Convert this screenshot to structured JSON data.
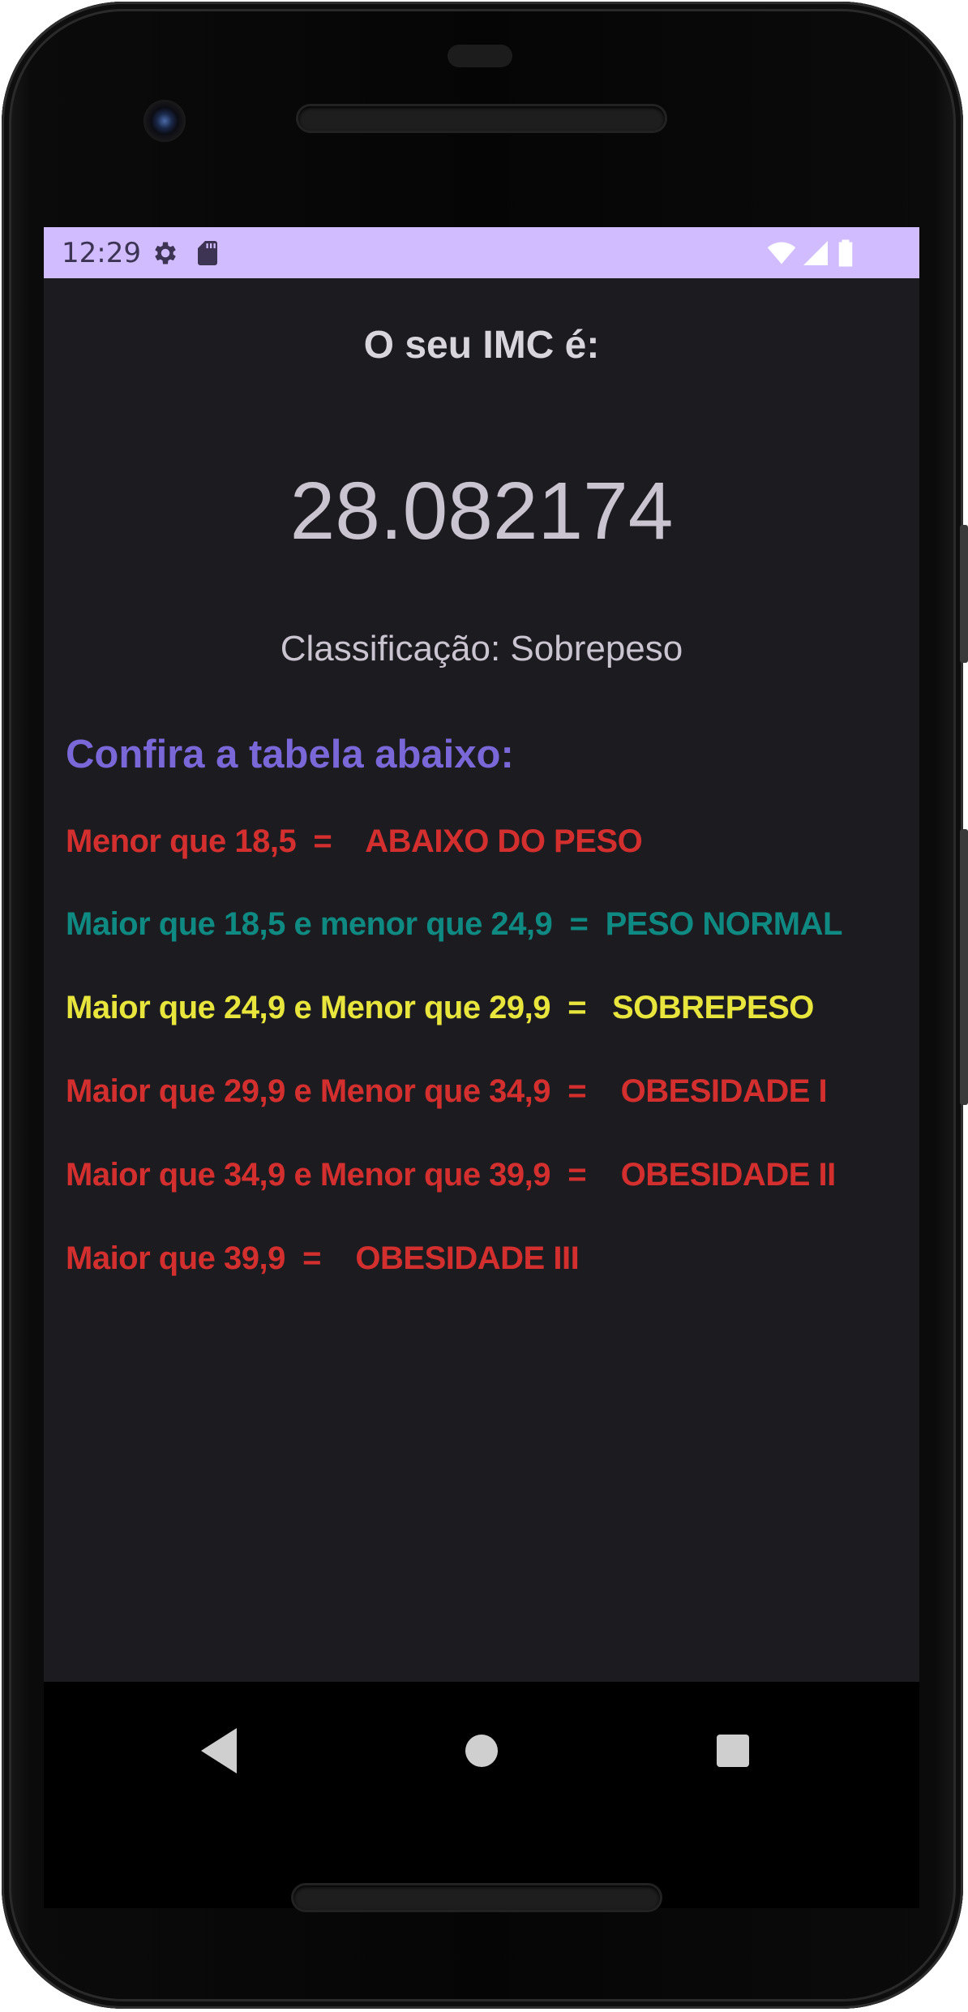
{
  "status_bar": {
    "time": "12:29",
    "icons": [
      "gear-icon",
      "sd-card-icon",
      "wifi-icon",
      "signal-icon",
      "battery-icon"
    ]
  },
  "screen": {
    "title": "O seu IMC é:",
    "imc_value": "28.082174",
    "classification": "Classificação: Sobrepeso",
    "table_heading": "Confira a tabela abaixo:"
  },
  "table": [
    {
      "text": "Menor que 18,5  =    ABAIXO DO PESO",
      "color": "#d32f2f"
    },
    {
      "text": "Maior que 18,5 e menor que 24,9  =  PESO NORMAL",
      "color": "#0f8a82"
    },
    {
      "text": "Maior que 24,9 e Menor que 29,9  =   SOBREPESO",
      "color": "#e8e63d"
    },
    {
      "text": "Maior que 29,9 e Menor que 34,9  =    OBESIDADE I",
      "color": "#d32f2f"
    },
    {
      "text": "Maior que 34,9 e Menor que 39,9  =    OBESIDADE II",
      "color": "#d32f2f"
    },
    {
      "text": "Maior que 39,9  =    OBESIDADE III",
      "color": "#d32f2f"
    }
  ],
  "nav_bar": {
    "buttons": [
      "back-icon",
      "home-icon",
      "recents-icon"
    ]
  },
  "colors": {
    "status_bar": "#d0bcff",
    "app_background": "#1c1b1f",
    "heading_accent": "#7a67d8"
  }
}
